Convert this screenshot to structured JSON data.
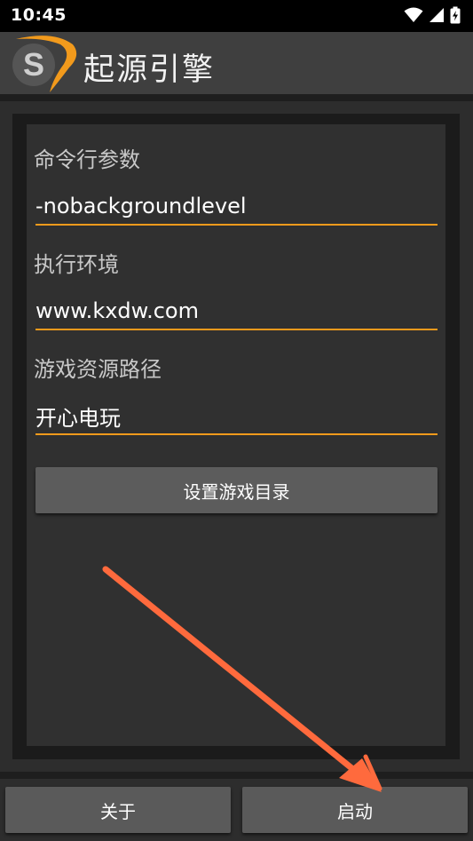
{
  "status_bar": {
    "time": "10:45",
    "icons": [
      "wifi-icon",
      "signal-icon",
      "battery-charging-icon"
    ]
  },
  "app_bar": {
    "title": "起源引擎",
    "logo_letter": "S",
    "logo_icon": "source-engine-logo"
  },
  "form": {
    "cmdline_label": "命令行参数",
    "cmdline_value": "-nobackgroundlevel",
    "env_label": "执行环境",
    "env_value": "www.kxdw.com",
    "gamepath_label": "游戏资源路径",
    "gamepath_value": "开心电玩",
    "set_dir_button": "设置游戏目录"
  },
  "bottom_bar": {
    "about_button": "关于",
    "launch_button": "启动"
  },
  "colors": {
    "accent": "#f29a1c",
    "annotation_arrow": "#ff6a3d",
    "background": "#2d2d2d",
    "app_bar": "#3f3f3f"
  }
}
